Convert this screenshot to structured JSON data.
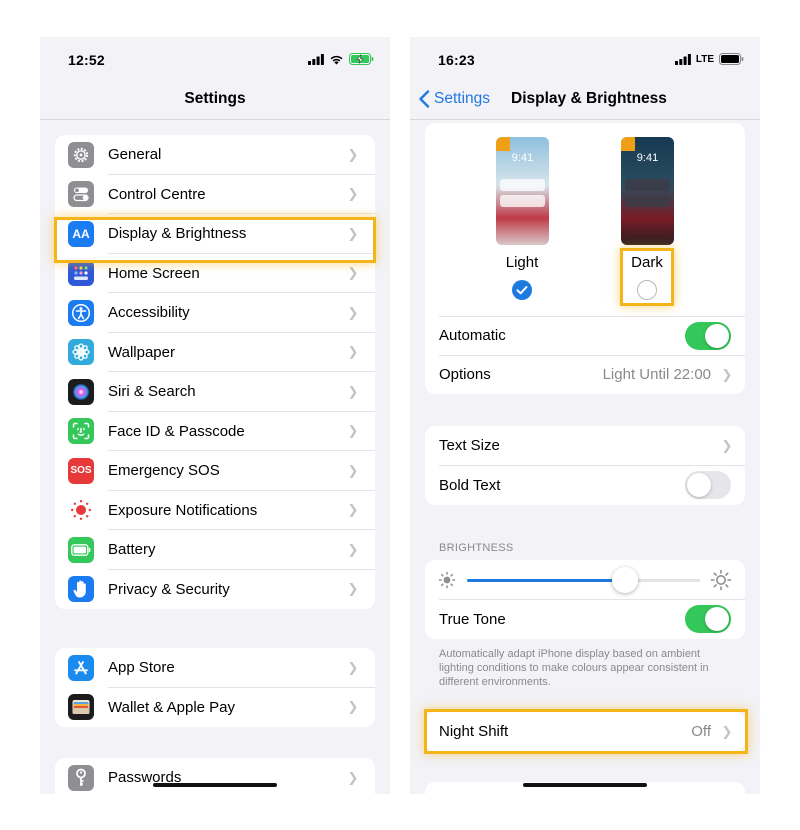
{
  "left": {
    "time": "12:52",
    "title": "Settings",
    "group1": [
      {
        "label": "General",
        "icon": "gear-icon",
        "color": "#8e8e93"
      },
      {
        "label": "Control Centre",
        "icon": "toggles-icon",
        "color": "#8e8e93"
      },
      {
        "label": "Display & Brightness",
        "icon": "text-size-icon",
        "color": "#1a7cf0"
      },
      {
        "label": "Home Screen",
        "icon": "grid-icon",
        "color": "#2e58d8"
      },
      {
        "label": "Accessibility",
        "icon": "accessibility-icon",
        "color": "#1a7cf0"
      },
      {
        "label": "Wallpaper",
        "icon": "flower-icon",
        "color": "#33aadc"
      },
      {
        "label": "Siri & Search",
        "icon": "siri-icon",
        "color": "#222222"
      },
      {
        "label": "Face ID & Passcode",
        "icon": "face-id-icon",
        "color": "#34c759"
      },
      {
        "label": "Emergency SOS",
        "icon": "sos-icon",
        "color": "#e8393a"
      },
      {
        "label": "Exposure Notifications",
        "icon": "exposure-icon",
        "color": "#ffffff"
      },
      {
        "label": "Battery",
        "icon": "battery-icon",
        "color": "#34c759"
      },
      {
        "label": "Privacy & Security",
        "icon": "hand-icon",
        "color": "#1a7cf0"
      }
    ],
    "group2": [
      {
        "label": "App Store",
        "icon": "app-store-icon",
        "color": "#1a8cf0"
      },
      {
        "label": "Wallet & Apple Pay",
        "icon": "wallet-icon",
        "color": "#222222"
      }
    ],
    "group3": [
      {
        "label": "Passwords",
        "icon": "key-icon",
        "color": "#8e8e93"
      }
    ],
    "sos_text": "SOS",
    "aa_text": "AA"
  },
  "right": {
    "time": "16:23",
    "network": "LTE",
    "back_label": "Settings",
    "title": "Display & Brightness",
    "appearance": {
      "light_label": "Light",
      "dark_label": "Dark",
      "light_time": "9:41",
      "dark_time": "9:41",
      "selected": "Light"
    },
    "automatic_label": "Automatic",
    "automatic_on": true,
    "options_label": "Options",
    "options_value": "Light Until 22:00",
    "text_size_label": "Text Size",
    "bold_text_label": "Bold Text",
    "bold_text_on": false,
    "brightness_header": "BRIGHTNESS",
    "brightness_level": 0.7,
    "true_tone_label": "True Tone",
    "true_tone_on": true,
    "true_tone_note": "Automatically adapt iPhone display based on ambient lighting conditions to make colours appear consistent in different environments.",
    "night_shift_label": "Night Shift",
    "night_shift_value": "Off"
  },
  "colors": {
    "accent": "#1f7ae0",
    "toggle_on": "#34c759",
    "highlight": "#f5b419"
  }
}
